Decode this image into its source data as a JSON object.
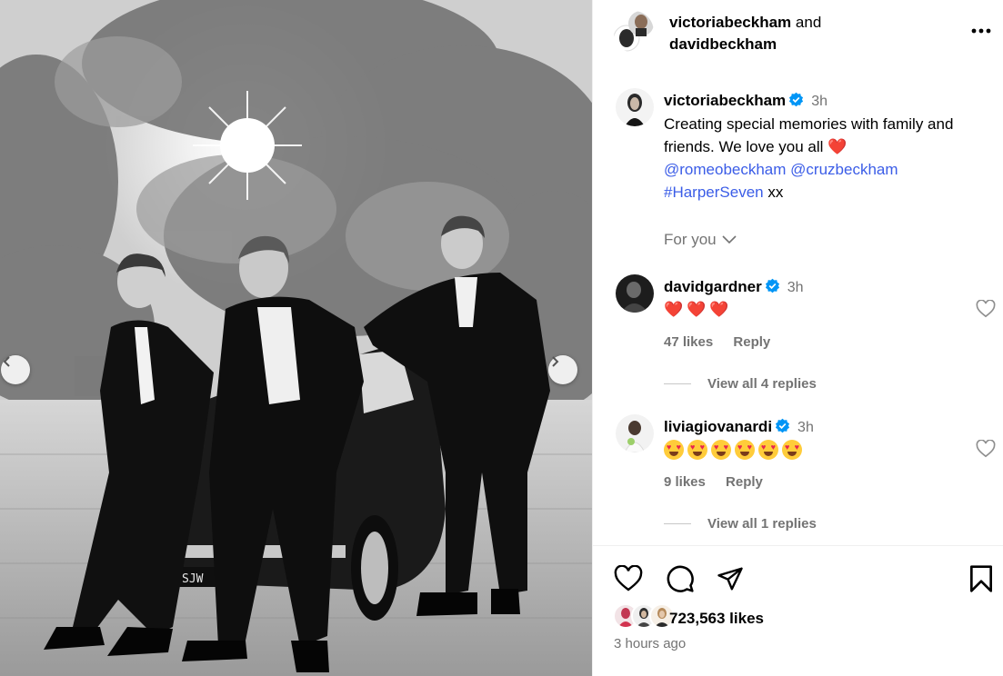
{
  "post": {
    "header": {
      "username_1": "victoriabeckham",
      "and_text": "and",
      "username_2": "davidbeckham",
      "more_icon": "more-horizontal-icon"
    },
    "caption": {
      "username": "victoriabeckham",
      "time": "3h",
      "text": "Creating special memories with family and friends. We love you all",
      "heart": "❤️",
      "mention_1": "@romeobeckham",
      "mention_2": "@cruzbeckham",
      "hashtag": "#HarperSeven",
      "suffix": "xx"
    },
    "translation_toggle": "For you"
  },
  "comments": [
    {
      "username": "davidgardner",
      "verified": true,
      "time": "3h",
      "body": "❤️❤️❤️",
      "likes": "47 likes",
      "reply_label": "Reply",
      "view_replies": "View all 4 replies"
    },
    {
      "username": "liviagiovanardi",
      "verified": true,
      "time": "3h",
      "body_emoji_count": 6,
      "likes": "9 likes",
      "reply_label": "Reply",
      "view_replies": "View all 1 replies"
    }
  ],
  "actions": {
    "like_icon": "heart-outline-icon",
    "comment_icon": "comment-bubble-icon",
    "share_icon": "paper-plane-icon",
    "save_icon": "bookmark-icon"
  },
  "likes_count": "723,563 likes",
  "posted_ago": "3 hours ago",
  "colors": {
    "link": "#3b5de7",
    "verified": "#0095f6",
    "meta_gray": "#737373",
    "heart_red": "#ef2d5e"
  }
}
